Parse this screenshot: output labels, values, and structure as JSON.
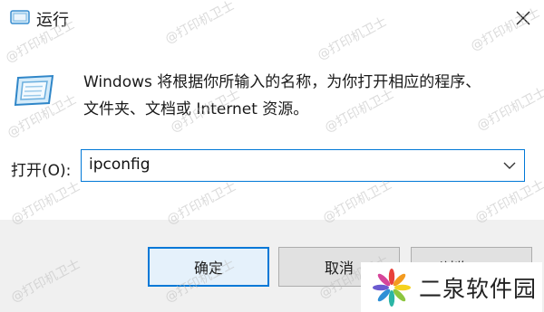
{
  "window": {
    "title": "运行",
    "close_label": "关闭"
  },
  "dialog": {
    "description_line1": "Windows 将根据你所输入的名称，为你打开相应的程序、",
    "description_line2": "文件夹、文档或 Internet 资源。",
    "open_label": "打开(O):",
    "input_value": "ipconfig"
  },
  "buttons": {
    "ok": "确定",
    "cancel": "取消",
    "browse": "浏览(B)..."
  },
  "watermark": "@打印机卫士",
  "logo": {
    "text": "二泉软件园"
  },
  "colors": {
    "accent": "#0078d7",
    "footer_bg": "#f0f0f0",
    "button_bg": "#e1e1e1"
  }
}
